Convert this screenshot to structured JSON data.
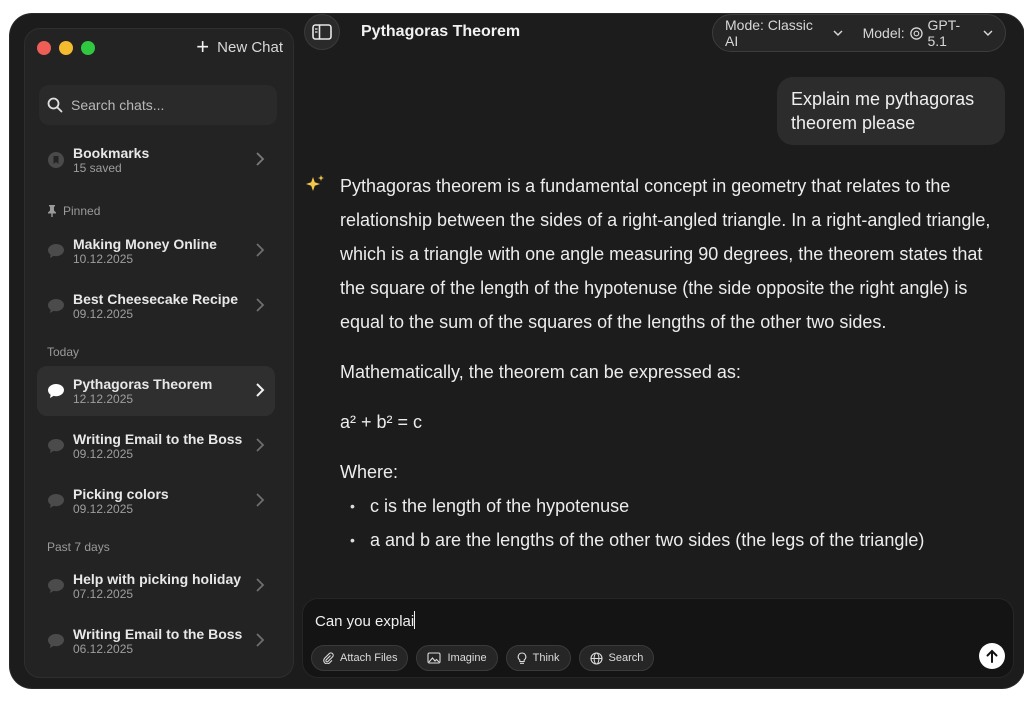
{
  "sidebar": {
    "new_chat": "New Chat",
    "search_placeholder": "Search chats...",
    "bookmarks": {
      "title": "Bookmarks",
      "sub": "15 saved"
    },
    "pinned_label": "Pinned",
    "pinned": [
      {
        "title": "Making Money Online",
        "date": "10.12.2025"
      },
      {
        "title": "Best Cheesecake Recipe",
        "date": "09.12.2025"
      }
    ],
    "today_label": "Today",
    "today": [
      {
        "title": "Pythagoras Theorem",
        "date": "12.12.2025"
      },
      {
        "title": "Writing Email to the Boss",
        "date": "09.12.2025"
      },
      {
        "title": "Picking colors",
        "date": "09.12.2025"
      }
    ],
    "past_label": "Past 7 days",
    "past": [
      {
        "title": "Help with picking holiday",
        "date": "07.12.2025"
      },
      {
        "title": "Writing Email to the Boss",
        "date": "06.12.2025"
      }
    ]
  },
  "header": {
    "title": "Pythagoras Theorem",
    "mode": "Mode: Classic AI",
    "model": "Model:",
    "model_name": "GPT-5.1"
  },
  "chat": {
    "user_message": "Explain me pythagoras theorem please",
    "answer_p1": "Pythagoras theorem is a fundamental concept in geometry that relates to the relationship between the sides of a right-angled triangle. In a right-angled triangle, which is a triangle with one angle measuring 90 degrees, the theorem states that the square of the length of the hypotenuse (the side opposite the right angle) is equal to the sum of the squares of the lengths of the other two sides.",
    "answer_p2": "Mathematically, the theorem can be expressed as:",
    "formula": "a² + b² = c",
    "where": "Where:",
    "bullets": [
      "c is the length of the hypotenuse",
      "a and b are the lengths of the other two sides (the legs of the triangle)"
    ]
  },
  "composer": {
    "value": "Can you explai",
    "attach": "Attach Files",
    "imagine": "Imagine",
    "think": "Think",
    "search": "Search"
  }
}
